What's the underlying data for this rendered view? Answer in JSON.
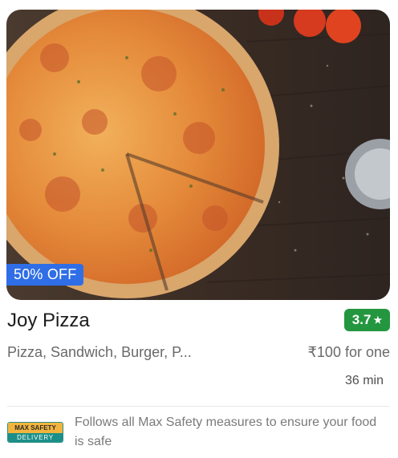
{
  "restaurant": {
    "name": "Joy Pizza",
    "rating": "3.7",
    "cuisines": "Pizza, Sandwich, Burger, P...",
    "price": "₹100 for one",
    "delivery_time": "36 min",
    "offer": "50% OFF"
  },
  "safety": {
    "badge_top": "MAX SAFETY",
    "badge_bottom": "DELIVERY",
    "text": "Follows all Max Safety measures to ensure your food is safe"
  },
  "colors": {
    "offer_bg": "#2f6ee6",
    "rating_bg": "#24963f",
    "badge_gold": "#f2b43c",
    "badge_teal": "#1c8f89"
  },
  "icons": {
    "rating": "star-icon"
  }
}
